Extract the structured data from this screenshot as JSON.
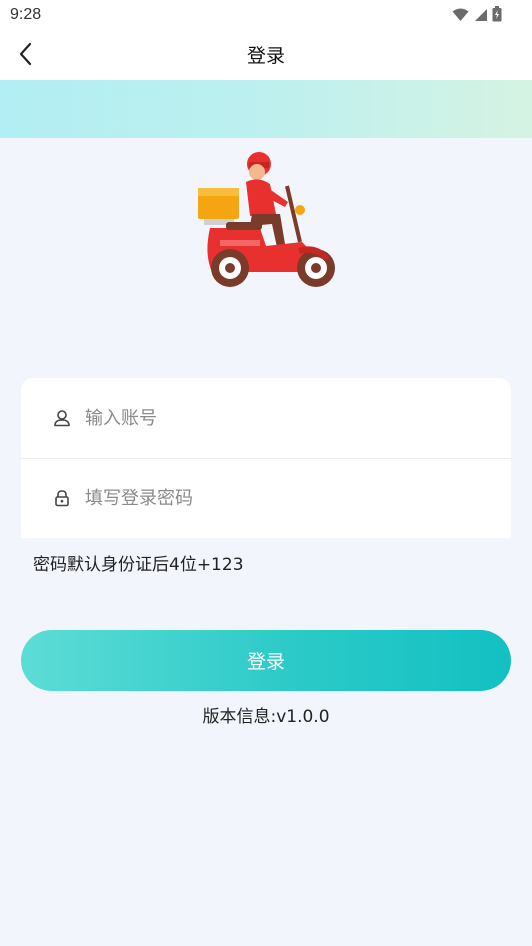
{
  "status_bar": {
    "time": "9:28",
    "icons": [
      "wifi-icon",
      "cellular-signal-icon",
      "battery-icon"
    ]
  },
  "header": {
    "title": "登录",
    "back_icon": "chevron-left-icon"
  },
  "colors": {
    "background": "#f2f5fb",
    "banner_start": "#b2eef3",
    "banner_end": "#d5f3e2",
    "button_start": "#5ddcd6",
    "button_end": "#13c0c2"
  },
  "illustration": {
    "name": "delivery-scooter-illustration"
  },
  "form": {
    "account": {
      "icon": "user-icon",
      "value": "",
      "placeholder": "输入账号"
    },
    "password": {
      "icon": "lock-icon",
      "value": "",
      "placeholder": "填写登录密码"
    },
    "hint": "密码默认身份证后4位+123"
  },
  "login_button": {
    "label": "登录"
  },
  "footer": {
    "version": "版本信息:v1.0.0"
  }
}
